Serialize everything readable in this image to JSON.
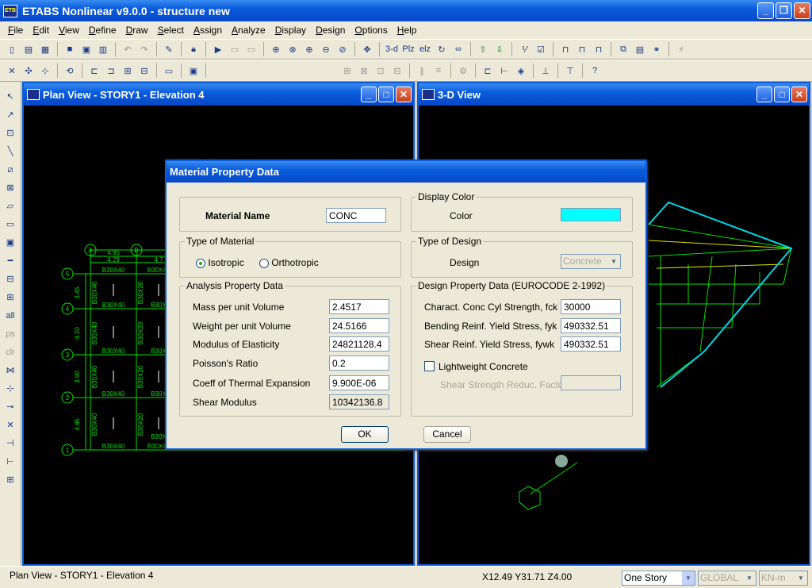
{
  "app": {
    "title": "ETABS Nonlinear v9.0.0 - structure new"
  },
  "menu": [
    "File",
    "Edit",
    "View",
    "Define",
    "Draw",
    "Select",
    "Assign",
    "Analyze",
    "Display",
    "Design",
    "Options",
    "Help"
  ],
  "toolbar": {
    "view_3d": "3-d",
    "plan": "Plz",
    "elev": "elz"
  },
  "left_toolbar": {
    "all": "all",
    "ps": "ps",
    "clr": "clr"
  },
  "plan_view": {
    "title": "Plan View - STORY1 - Elevation 4",
    "grid_x": [
      "A",
      "B"
    ],
    "grid_y": [
      "5",
      "4",
      "3",
      "2",
      "1"
    ],
    "dims_x": [
      "4.95",
      "4.29",
      "4.7"
    ],
    "dims_y": [
      "3.45",
      "4.20",
      "3.90",
      "4.95"
    ],
    "beam_labels": [
      "B30X40",
      "B30X40",
      "B30X40",
      "B30X40",
      "B30X40",
      "B30X40",
      "B30X40"
    ],
    "beam_side": [
      "B30X40",
      "B30X40",
      "B30X40",
      "B30X40"
    ],
    "beam_mid": [
      "B30X20",
      "B30X20",
      "B30X20",
      "B30X20"
    ],
    "beam_right": [
      "B30X",
      "B30X",
      "B30X",
      "B30X"
    ]
  },
  "view_3d": {
    "title": "3-D View"
  },
  "dialog": {
    "title": "Material Property Data",
    "material_name_label": "Material Name",
    "material_name": "CONC",
    "display_color_legend": "Display Color",
    "color_label": "Color",
    "color_value": "#00ffff",
    "type_of_material_legend": "Type of Material",
    "isotropic": "Isotropic",
    "orthotropic": "Orthotropic",
    "type_of_design_legend": "Type of Design",
    "design_label": "Design",
    "design_value": "Concrete",
    "analysis_legend": "Analysis Property Data",
    "analysis": [
      {
        "label": "Mass per unit Volume",
        "value": "2.4517"
      },
      {
        "label": "Weight per unit Volume",
        "value": "24.5166"
      },
      {
        "label": "Modulus of Elasticity",
        "value": "24821128.4"
      },
      {
        "label": "Poisson's Ratio",
        "value": "0.2"
      },
      {
        "label": "Coeff of Thermal Expansion",
        "value": "9.900E-06"
      },
      {
        "label": "Shear Modulus",
        "value": "10342136.8"
      }
    ],
    "design_prop_legend": "Design Property Data (EUROCODE 2-1992)",
    "design_props": [
      {
        "label": "Charact. Conc Cyl Strength, fck",
        "value": "30000"
      },
      {
        "label": "Bending Reinf. Yield Stress, fyk",
        "value": "490332.51"
      },
      {
        "label": "Shear Reinf. Yield Stress, fywk",
        "value": "490332.51"
      }
    ],
    "lightweight_label": "Lightweight Concrete",
    "shear_factor_label": "Shear Strength Reduc. Factor",
    "ok": "OK",
    "cancel": "Cancel"
  },
  "status": {
    "text": "Plan View - STORY1 - Elevation 4",
    "coords": "X12.49  Y31.71  Z4.00",
    "story": "One Story",
    "coord_sys": "GLOBAL",
    "units": "KN-m"
  }
}
